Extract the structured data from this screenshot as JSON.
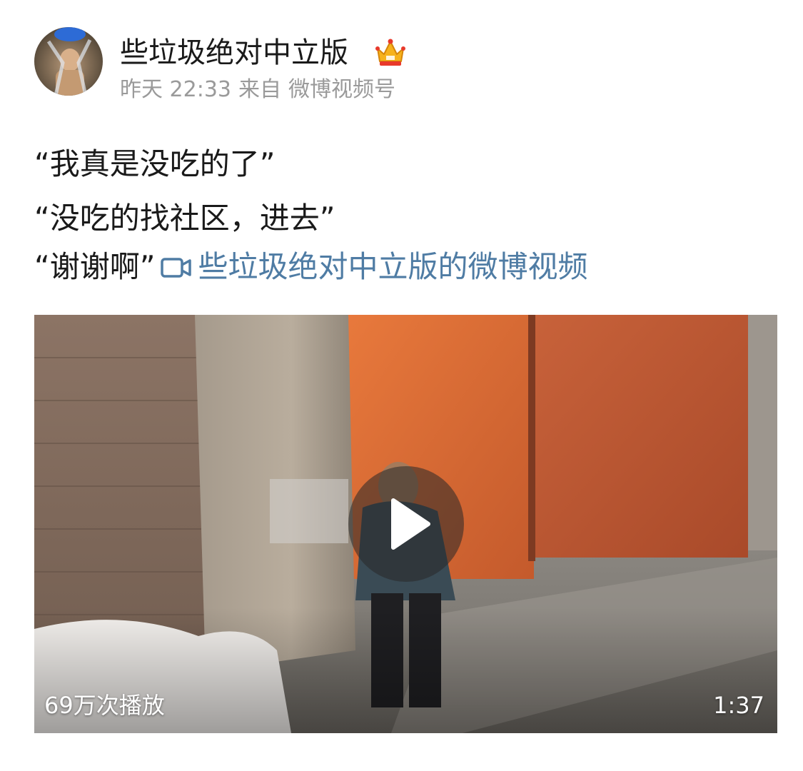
{
  "post": {
    "username": "些垃圾绝对中立版",
    "badge_icon": "crown-icon",
    "time": "昨天 22:33",
    "source_prefix": "来自",
    "source": "微博视频号",
    "lines": [
      "“我真是没吃的了”",
      "“没吃的找社区，进去”",
      "“谢谢啊”"
    ],
    "video_link": {
      "icon": "video-camera-icon",
      "label": "些垃圾绝对中立版的微博视频",
      "color": "#4f7ca4"
    }
  },
  "video": {
    "play_count": "69万次播放",
    "duration": "1:37",
    "play_icon": "play-icon"
  }
}
